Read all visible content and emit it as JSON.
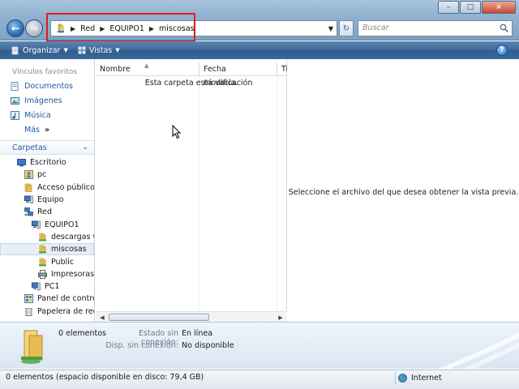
{
  "window": {
    "controls": [
      "–",
      "□",
      "×"
    ]
  },
  "address": {
    "crumbs": [
      "Red",
      "EQUIPO1",
      "miscosas"
    ]
  },
  "search": {
    "placeholder": "Buscar"
  },
  "toolbar": {
    "organize_label": "Organizar",
    "views_label": "Vistas",
    "help_label": "?"
  },
  "nav": {
    "favorites_title": "Vínculos favoritos",
    "favorites": [
      {
        "label": "Documentos",
        "icon": "documents-icon"
      },
      {
        "label": "Imágenes",
        "icon": "pictures-icon"
      },
      {
        "label": "Música",
        "icon": "music-icon"
      }
    ],
    "more_label": "Más",
    "more_arrow": "»",
    "folders_title": "Carpetas",
    "tree": [
      {
        "label": "Escritorio",
        "indent": 0,
        "icon": "desktop-icon"
      },
      {
        "label": "pc",
        "indent": 1,
        "icon": "user-folder-icon"
      },
      {
        "label": "Acceso público",
        "indent": 1,
        "icon": "folder-icon"
      },
      {
        "label": "Equipo",
        "indent": 1,
        "icon": "computer-icon"
      },
      {
        "label": "Red",
        "indent": 1,
        "icon": "network-icon"
      },
      {
        "label": "EQUIPO1",
        "indent": 2,
        "icon": "computer-icon"
      },
      {
        "label": "descargas w",
        "indent": 3,
        "icon": "shared-folder-icon"
      },
      {
        "label": "miscosas",
        "indent": 3,
        "icon": "shared-folder-icon",
        "selected": true
      },
      {
        "label": "Public",
        "indent": 3,
        "icon": "shared-folder-icon"
      },
      {
        "label": "Impresoras",
        "indent": 3,
        "icon": "printer-icon"
      },
      {
        "label": "PC1",
        "indent": 2,
        "icon": "computer-icon"
      },
      {
        "label": "Panel de contro",
        "indent": 1,
        "icon": "control-panel-icon"
      },
      {
        "label": "Papelera de reci",
        "indent": 1,
        "icon": "recycle-bin-icon"
      }
    ]
  },
  "files": {
    "columns": [
      "Nombre",
      "Fecha modificación",
      "Ti"
    ],
    "empty_message": "Esta carpeta está vacía."
  },
  "preview": {
    "message": "Seleccione el archivo del que desea obtener la vista previa."
  },
  "details": {
    "count": "0 elementos",
    "offline_status_label": "Estado sin conexión:",
    "offline_status_value": "En línea",
    "offline_avail_label": "Disp. sin conexión:",
    "offline_avail_value": "No disponible"
  },
  "status": {
    "left": "0 elementos (espacio disponible en disco: 79,4 GB)",
    "zone": "Internet"
  },
  "colors": {
    "highlight_box": "#e01d1d",
    "link_blue": "#1f5a9e",
    "toolbar_blue": "#3d6898"
  }
}
